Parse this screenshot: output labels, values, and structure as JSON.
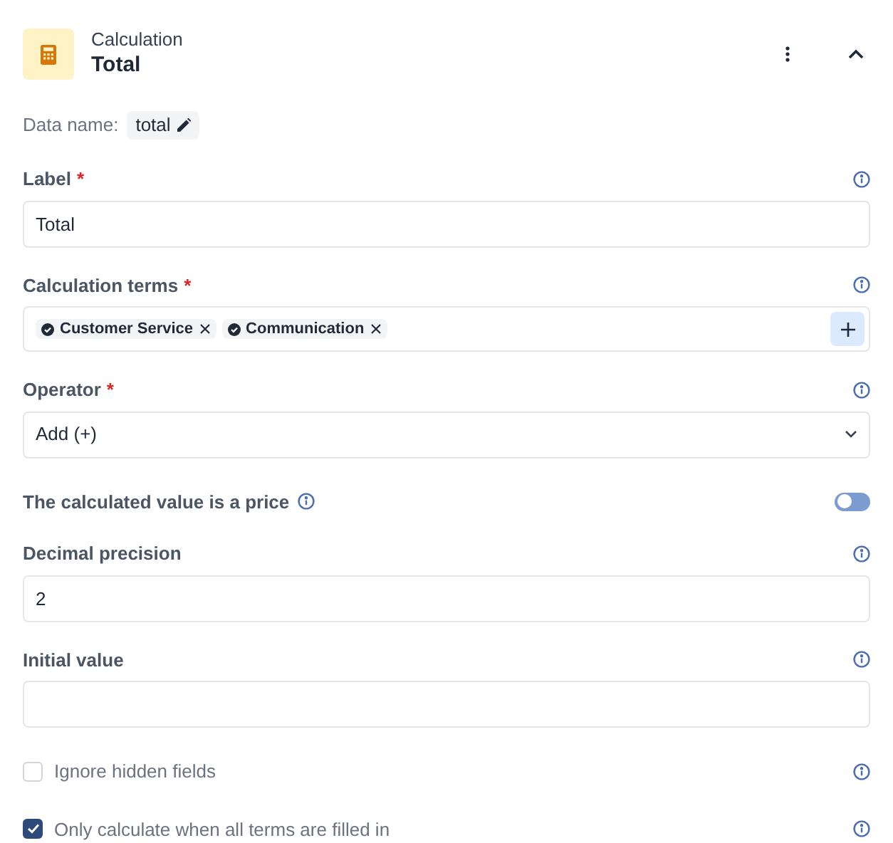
{
  "header": {
    "subtitle": "Calculation",
    "title": "Total"
  },
  "data_name": {
    "label": "Data name:",
    "value": "total"
  },
  "fields": [
    {
      "kind": "text",
      "label": "Label",
      "required_mark": "*",
      "value": "Total"
    },
    {
      "kind": "tags",
      "label": "Calculation terms",
      "required_mark": "*",
      "tags": [
        "Customer Service",
        "Communication"
      ]
    },
    {
      "kind": "select",
      "label": "Operator",
      "required_mark": "*",
      "value": "Add (+)"
    },
    {
      "kind": "toggle",
      "label": "The calculated value is a price",
      "on": false
    },
    {
      "kind": "text",
      "label": "Decimal precision",
      "value": "2"
    },
    {
      "kind": "text",
      "label": "Initial value"
    },
    {
      "kind": "checkbox",
      "label": "Ignore hidden fields",
      "checked": false
    },
    {
      "kind": "checkbox",
      "label": "Only calculate when all terms are filled in",
      "checked": true
    }
  ]
}
